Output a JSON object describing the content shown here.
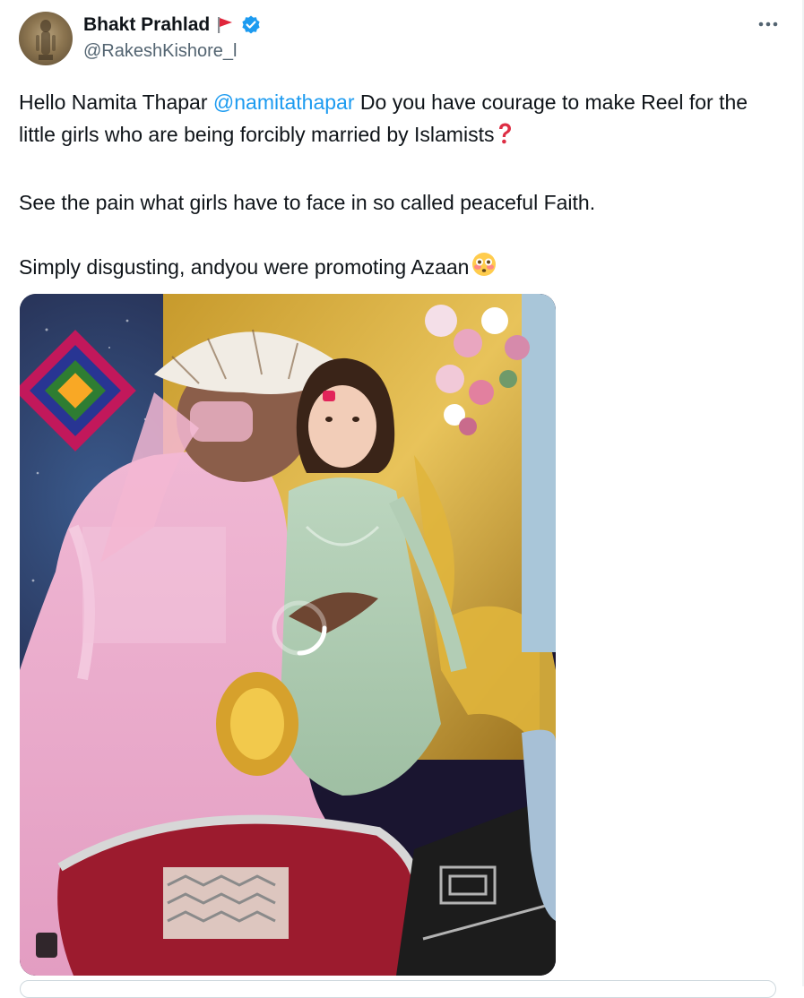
{
  "tweet": {
    "author": {
      "display_name": "Bhakt Prahlad",
      "handle": "@RakeshKishore_l",
      "flag_icon": "red-flag-icon",
      "verified_icon": "verified-badge-icon",
      "verified_color": "#1d9bf0"
    },
    "more_icon": "more-horizontal-icon",
    "body": {
      "line1_prefix": "Hello Namita Thapar ",
      "mention": "@namitathapar",
      "line1_suffix": " Do you have courage to make Reel for the little girls who are being forcibly married by Islamists",
      "line1_emoji": "red-question-mark-icon",
      "paragraph2": "See the pain what girls have to face in so called peaceful Faith.",
      "paragraph3": "Simply disgusting, andyou were promoting Azaan",
      "paragraph3_emoji": "flushed-face-icon"
    },
    "media": {
      "kind": "video-thumbnail",
      "loading_indicator": "loading-spinner-icon"
    }
  },
  "colors": {
    "text": "#0f1419",
    "secondary": "#536471",
    "link": "#1d9bf0"
  }
}
